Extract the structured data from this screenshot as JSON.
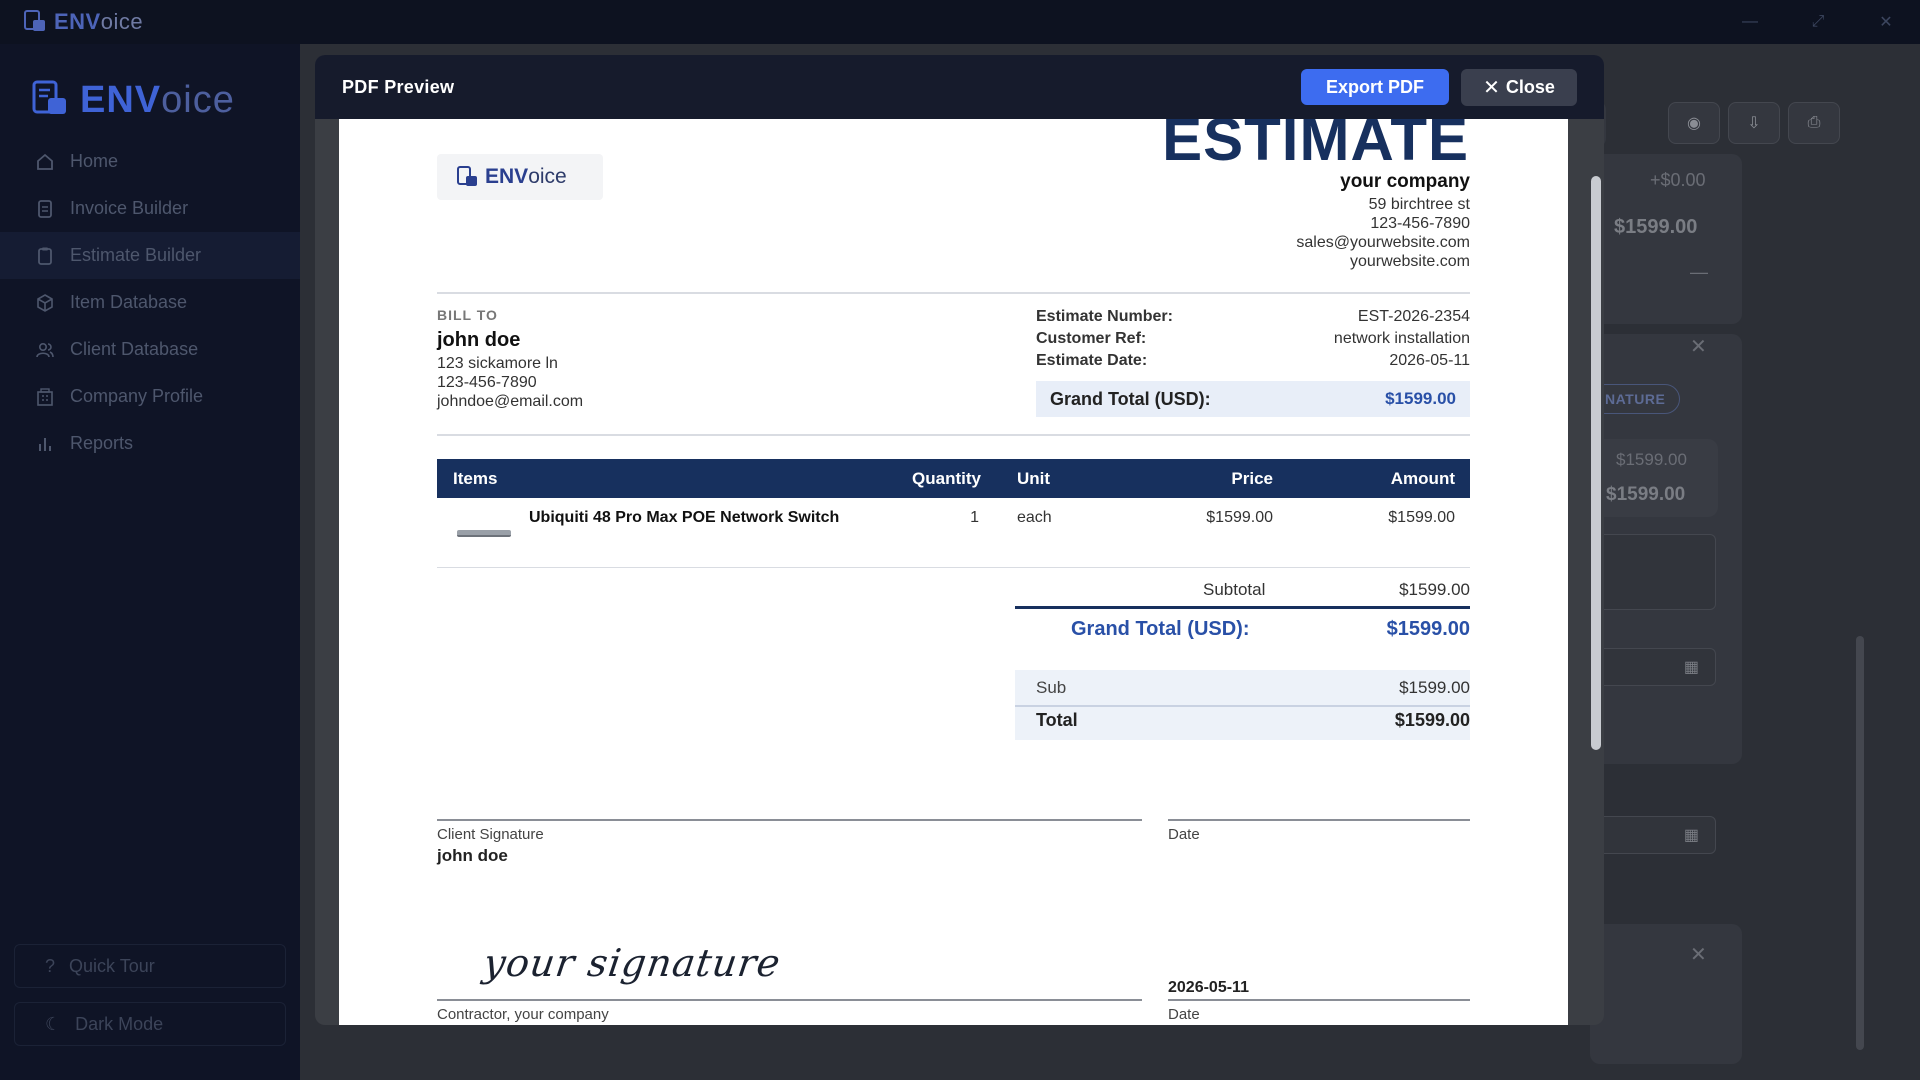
{
  "app": {
    "title_bold": "ENV",
    "title_rest": "oice"
  },
  "sidebar": {
    "logo_bold": "ENV",
    "logo_rest": "oice",
    "items": [
      {
        "label": "Home",
        "icon": "home-icon"
      },
      {
        "label": "Invoice Builder",
        "icon": "file-icon"
      },
      {
        "label": "Estimate Builder",
        "icon": "clipboard-icon",
        "active": true
      },
      {
        "label": "Item Database",
        "icon": "box-icon"
      },
      {
        "label": "Client Database",
        "icon": "users-icon"
      },
      {
        "label": "Company Profile",
        "icon": "building-icon"
      },
      {
        "label": "Reports",
        "icon": "bar-chart-icon"
      }
    ],
    "quick_tour": "Quick Tour",
    "dark_mode": "Dark Mode"
  },
  "background": {
    "adjustment": "+$0.00",
    "total_top": "$1599.00",
    "dash": "—",
    "signature_pill": "NATURE",
    "sub_small": "$1599.00",
    "total_bold": "$1599.00"
  },
  "modal": {
    "title": "PDF Preview",
    "export_label": "Export PDF",
    "close_label": "Close"
  },
  "doc": {
    "logo_bold": "ENV",
    "logo_rest": "oice",
    "title": "ESTIMATE",
    "company": {
      "name": "your company",
      "address": "59 birchtree st",
      "phone": "123-456-7890",
      "email": "sales@yourwebsite.com",
      "website": "yourwebsite.com"
    },
    "bill_to": {
      "label": "BILL TO",
      "name": "john doe",
      "address": "123 sickamore ln",
      "phone": "123-456-7890",
      "email": "johndoe@email.com"
    },
    "meta": {
      "number_label": "Estimate Number:",
      "number": "EST-2026-2354",
      "ref_label": "Customer Ref:",
      "ref": "network installation",
      "date_label": "Estimate Date:",
      "date": "2026-05-11",
      "grand_label": "Grand Total (USD):",
      "grand_value": "$1599.00"
    },
    "table": {
      "headers": [
        "Items",
        "Quantity",
        "Unit",
        "Price",
        "Amount"
      ],
      "rows": [
        {
          "item": "Ubiquiti 48 Pro Max POE Network Switch",
          "quantity": "1",
          "unit": "each",
          "price": "$1599.00",
          "amount": "$1599.00"
        }
      ]
    },
    "totals": {
      "subtotal_label": "Subtotal",
      "subtotal": "$1599.00",
      "grand_label": "Grand Total (USD):",
      "grand": "$1599.00",
      "sub_label": "Sub",
      "sub": "$1599.00",
      "total_label": "Total",
      "total": "$1599.00"
    },
    "signatures": {
      "client_caption": "Client Signature",
      "client_name": "john doe",
      "date_caption": "Date",
      "contractor_signature": "your signature",
      "contractor_date": "2026-05-11",
      "contractor_caption": "Contractor, your company",
      "date_caption_2": "Date"
    }
  }
}
